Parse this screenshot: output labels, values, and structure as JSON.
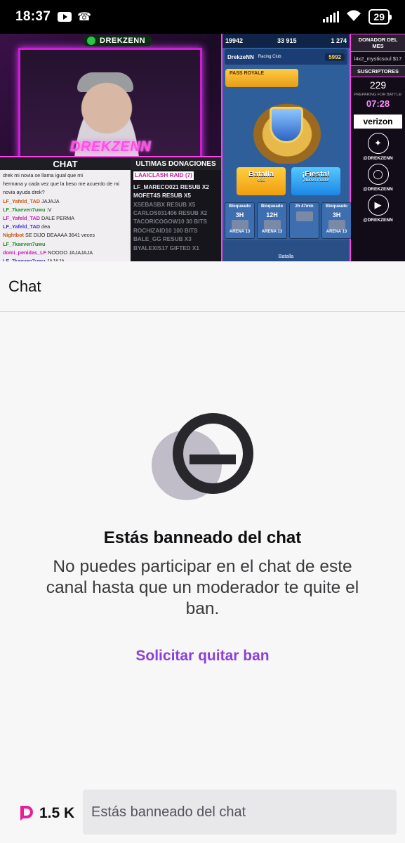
{
  "status_bar": {
    "time": "18:37",
    "battery": "29"
  },
  "stream": {
    "streamer_tag": "DREKZENN",
    "cam_name": "DREKZENN",
    "chat_title": "CHAT",
    "chat_lines": [
      {
        "user": "",
        "text": "drek mi novia se llama igual que mi"
      },
      {
        "user": "",
        "text": "hermana y cada vez que la beso me acuerdo de mi"
      },
      {
        "user": "",
        "text": "novia ayuda drek?"
      },
      {
        "user": "LF_Yafeld_TAD",
        "text": "JAJAJA"
      },
      {
        "user": "LF_7kaeven7uwu",
        "text": ":V"
      },
      {
        "user": "LF_Yafeld_TAD",
        "text": "DALE PERMA"
      },
      {
        "user": "LF_Yafeld_TAD",
        "text": "dea"
      },
      {
        "user": "Nightbot",
        "text": "SE DIJO DEAAAA 3641 veces"
      },
      {
        "user": "LF_7kaeven7uwu",
        "text": ""
      },
      {
        "user": "domi_penidas_LF",
        "text": "NOOOO JAJAJAJA"
      },
      {
        "user": "LF_7kaeven7uwu",
        "text": "JAJAJA"
      },
      {
        "user": "xThe_Gabriel",
        "text": "AJAJJAJAJ"
      }
    ],
    "donations_title": "ULTIMAS DONACIONES",
    "donations": [
      "LAAICLASH RAID (7)",
      "LF_MARECO021 RESUB X2",
      "MOFET4S RESUB X5",
      "XSEBASBX RESUB X5",
      "CARLOS031406 RESUB X2",
      "TACORICOGOW10 30 BITS",
      "ROCHIZAID10 100 BITS",
      "BALE_GG RESUB X3",
      "BYALEXIS17 GIFTED X1"
    ],
    "game": {
      "gems_left": "19942",
      "gold": "33 915",
      "gems": "1 274",
      "player": "DrekzeNN",
      "clan": "Racing Club",
      "trophies": "5992",
      "pass": "PASS ROYALE",
      "battle_label": "Batalla",
      "battle_sub": "4/30",
      "fiesta_label": "¡Fiesta!",
      "fiesta_sub": "¡Nuevo modo!",
      "chests": [
        {
          "status": "Bloqueado",
          "time": "3H",
          "arena": "ARENA 13"
        },
        {
          "status": "Bloqueado",
          "time": "12H",
          "arena": "ARENA 13"
        },
        {
          "status": "2h 47min",
          "time": "",
          "arena": ""
        },
        {
          "status": "Bloqueado",
          "time": "3H",
          "arena": "ARENA 13"
        }
      ],
      "bottom_label": "Batalla"
    },
    "side": {
      "donor_header": "DONADOR DEL MES",
      "donor": "l4x2_mysticsoul $17",
      "subs_header": "SUSCRIPTORES",
      "subs_count": "229",
      "battle_text": "PREPARING FOR BATTLE!",
      "timer": "07:28",
      "sponsor": "verizon",
      "handle_twitter": "@DREKZENN",
      "handle_instagram": "@DREKZENN",
      "handle_youtube": "@DREKZENN"
    }
  },
  "chat_header": {
    "title": "Chat"
  },
  "ban": {
    "title": "Estás banneado del chat",
    "description": "No puedes participar en el chat de este canal hasta que un moderador te quite el ban.",
    "request_label": "Solicitar quitar ban"
  },
  "bottom": {
    "bits_count": "1.5 K",
    "input_placeholder": "Estás banneado del chat"
  },
  "colors": {
    "accent": "#8c3fd9",
    "stream_accent": "#ff40e8",
    "text_primary": "#0e0e10"
  }
}
